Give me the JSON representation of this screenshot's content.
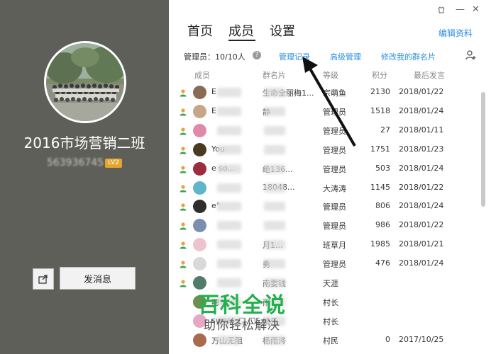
{
  "group": {
    "name": "2016市场营销二班",
    "id_masked": "563936745",
    "level": "LV2"
  },
  "left_actions": {
    "send_message": "发消息"
  },
  "window": {
    "controls": [
      "skin-icon",
      "minimize-icon",
      "close-icon"
    ]
  },
  "tabs": [
    {
      "label": "首页",
      "active": false
    },
    {
      "label": "成员",
      "active": true
    },
    {
      "label": "设置",
      "active": false
    }
  ],
  "edit_profile": "编辑资料",
  "toolbar": {
    "admin_count": "管理员：10/10人",
    "help": "?",
    "links": [
      "管理记录",
      "高级管理",
      "修改我的群名片"
    ]
  },
  "columns": [
    "成员",
    "群名片",
    "等级",
    "积分",
    "最后发言"
  ],
  "members": [
    {
      "name": "E",
      "card": "生命全丽梅1...",
      "level": "宗萌鱼",
      "points": "2130",
      "last": "2018/01/22",
      "admin": true,
      "color": "#8b6a52"
    },
    {
      "name": "E",
      "card": "静",
      "level": "管理员",
      "points": "1518",
      "last": "2018/01/24",
      "admin": true,
      "color": "#c7a58a"
    },
    {
      "name": "",
      "card": "",
      "level": "管理员",
      "points": "27",
      "last": "2018/01/11",
      "admin": true,
      "color": "#e08aa8"
    },
    {
      "name": "You",
      "card": "",
      "level": "管理员",
      "points": "1751",
      "last": "2018/01/23",
      "admin": true,
      "color": "#4a3b20"
    },
    {
      "name": "e so...",
      "card": "绝136...",
      "level": "管理员",
      "points": "503",
      "last": "2018/01/24",
      "admin": true,
      "color": "#9b2d3d"
    },
    {
      "name": "",
      "card": "18048...",
      "level": "大涛涛",
      "points": "1145",
      "last": "2018/01/22",
      "admin": true,
      "color": "#5db6c9"
    },
    {
      "name": "e°",
      "card": "",
      "level": "管理员",
      "points": "806",
      "last": "2018/01/24",
      "admin": true,
      "color": "#2e2e2e"
    },
    {
      "name": "",
      "card": "",
      "level": "管理员",
      "points": "986",
      "last": "2018/01/22",
      "admin": true,
      "color": "#7a8fb0"
    },
    {
      "name": "",
      "card": "月1...",
      "level": "班草月",
      "points": "1985",
      "last": "2018/01/21",
      "admin": true,
      "color": "#f0c2cf"
    },
    {
      "name": "",
      "card": "勇",
      "level": "管理员",
      "points": "476",
      "last": "2018/01/24",
      "admin": true,
      "color": "#d9d9d9"
    },
    {
      "name": "",
      "card": "南要钱",
      "level": "天涯",
      "points": "",
      "last": "",
      "admin": true,
      "color": "#4f7d6a"
    },
    {
      "name": "嗯",
      "card": "雨",
      "level": "村长",
      "points": "",
      "last": "",
      "admin": false,
      "color": "#6b8f4e"
    },
    {
      "name": "sweet_□ □□",
      "card": "姚乐",
      "level": "村长",
      "points": "",
      "last": "",
      "admin": false,
      "color": "#e7a8c4"
    },
    {
      "name": "万山无阻",
      "card": "杨雨涔",
      "level": "村民",
      "points": "0",
      "last": "2017/10/25",
      "admin": false,
      "color": "#a86b4d"
    }
  ],
  "watermark": {
    "title": "百科全说",
    "subtitle": "助你轻松解决"
  },
  "colors": {
    "left_bg": "#5f5f59",
    "link": "#2d8ee0",
    "level_badge": "#e7a42c",
    "watermark": "#22b14c"
  }
}
